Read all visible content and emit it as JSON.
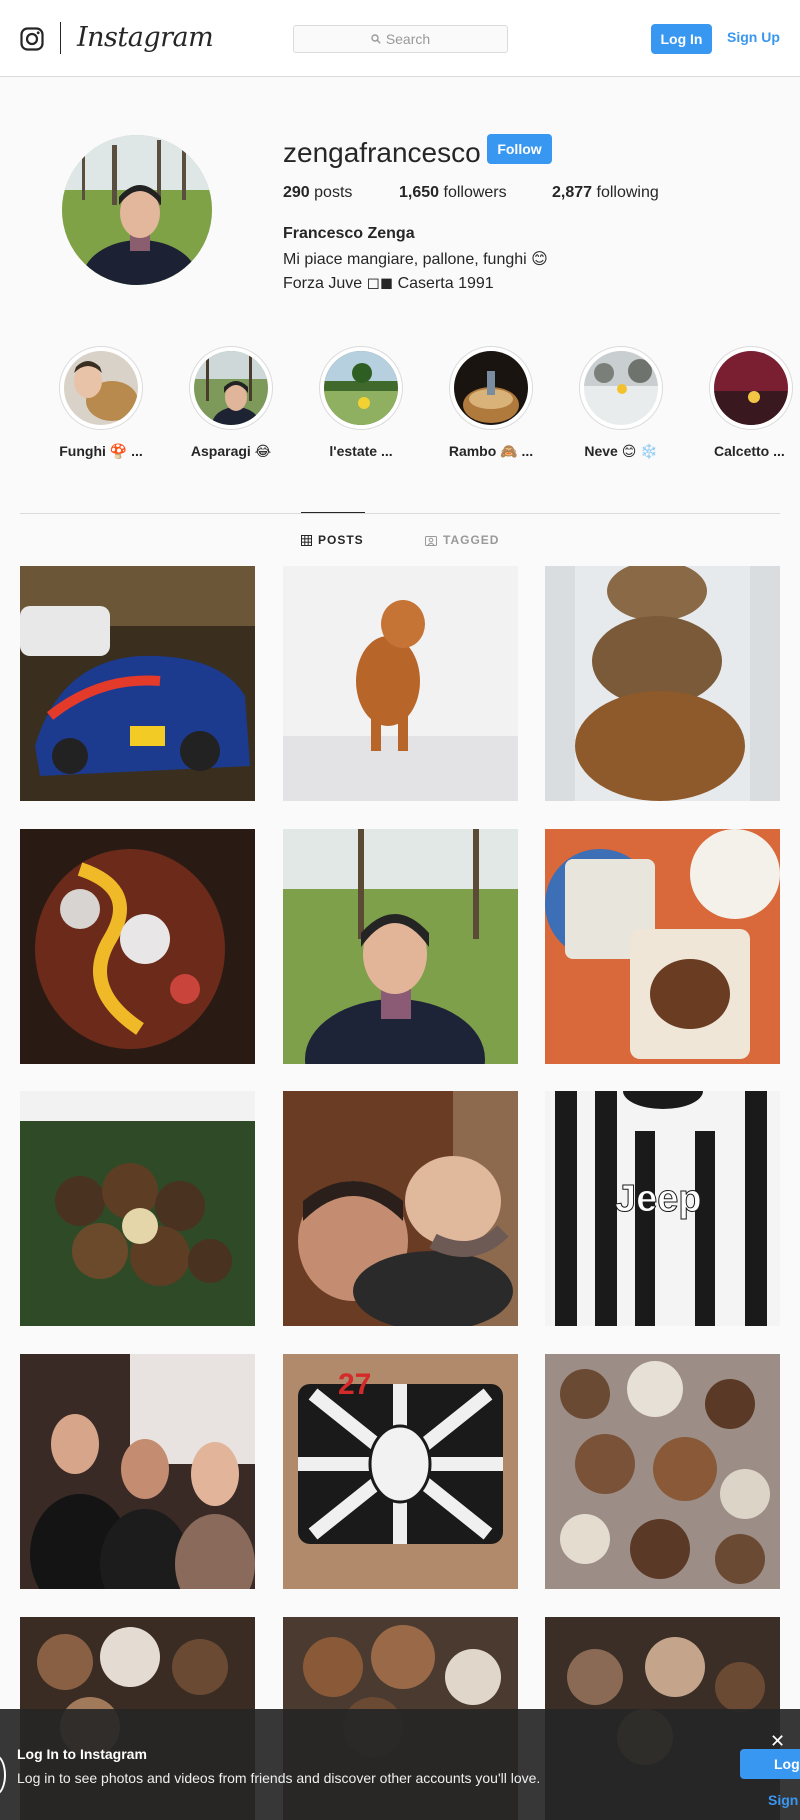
{
  "header": {
    "logo_text": "Instagram",
    "search_placeholder": "Search",
    "login_label": "Log In",
    "signup_label": "Sign Up"
  },
  "profile": {
    "username": "zengafrancesco",
    "follow_label": "Follow",
    "posts_count": "290",
    "posts_label": "posts",
    "followers_count": "1,650",
    "followers_label": "followers",
    "following_count": "2,877",
    "following_label": "following",
    "full_name": "Francesco Zenga",
    "bio_line1": "Mi piace mangiare, pallone, funghi 😊",
    "bio_line2": "Forza Juve ◻◼ Caserta 1991"
  },
  "highlights": [
    {
      "label": "Funghi 🍄 ..."
    },
    {
      "label": "Asparagi 😂"
    },
    {
      "label": "l'estate ..."
    },
    {
      "label": "Rambo 🙈 ..."
    },
    {
      "label": "Neve 😊 ❄️"
    },
    {
      "label": "Calcetto ..."
    }
  ],
  "tabs": {
    "posts": "POSTS",
    "tagged": "TAGGED"
  },
  "banner": {
    "title": "Log In to Instagram",
    "text": "Log in to see photos and videos from friends and discover other accounts you'll love.",
    "close": "✕",
    "login_label": "Log",
    "signup_label": "Sign"
  },
  "colors": {
    "accent": "#3897f0",
    "text": "#262626",
    "border": "#dbdbdb",
    "background": "#fafafa"
  }
}
